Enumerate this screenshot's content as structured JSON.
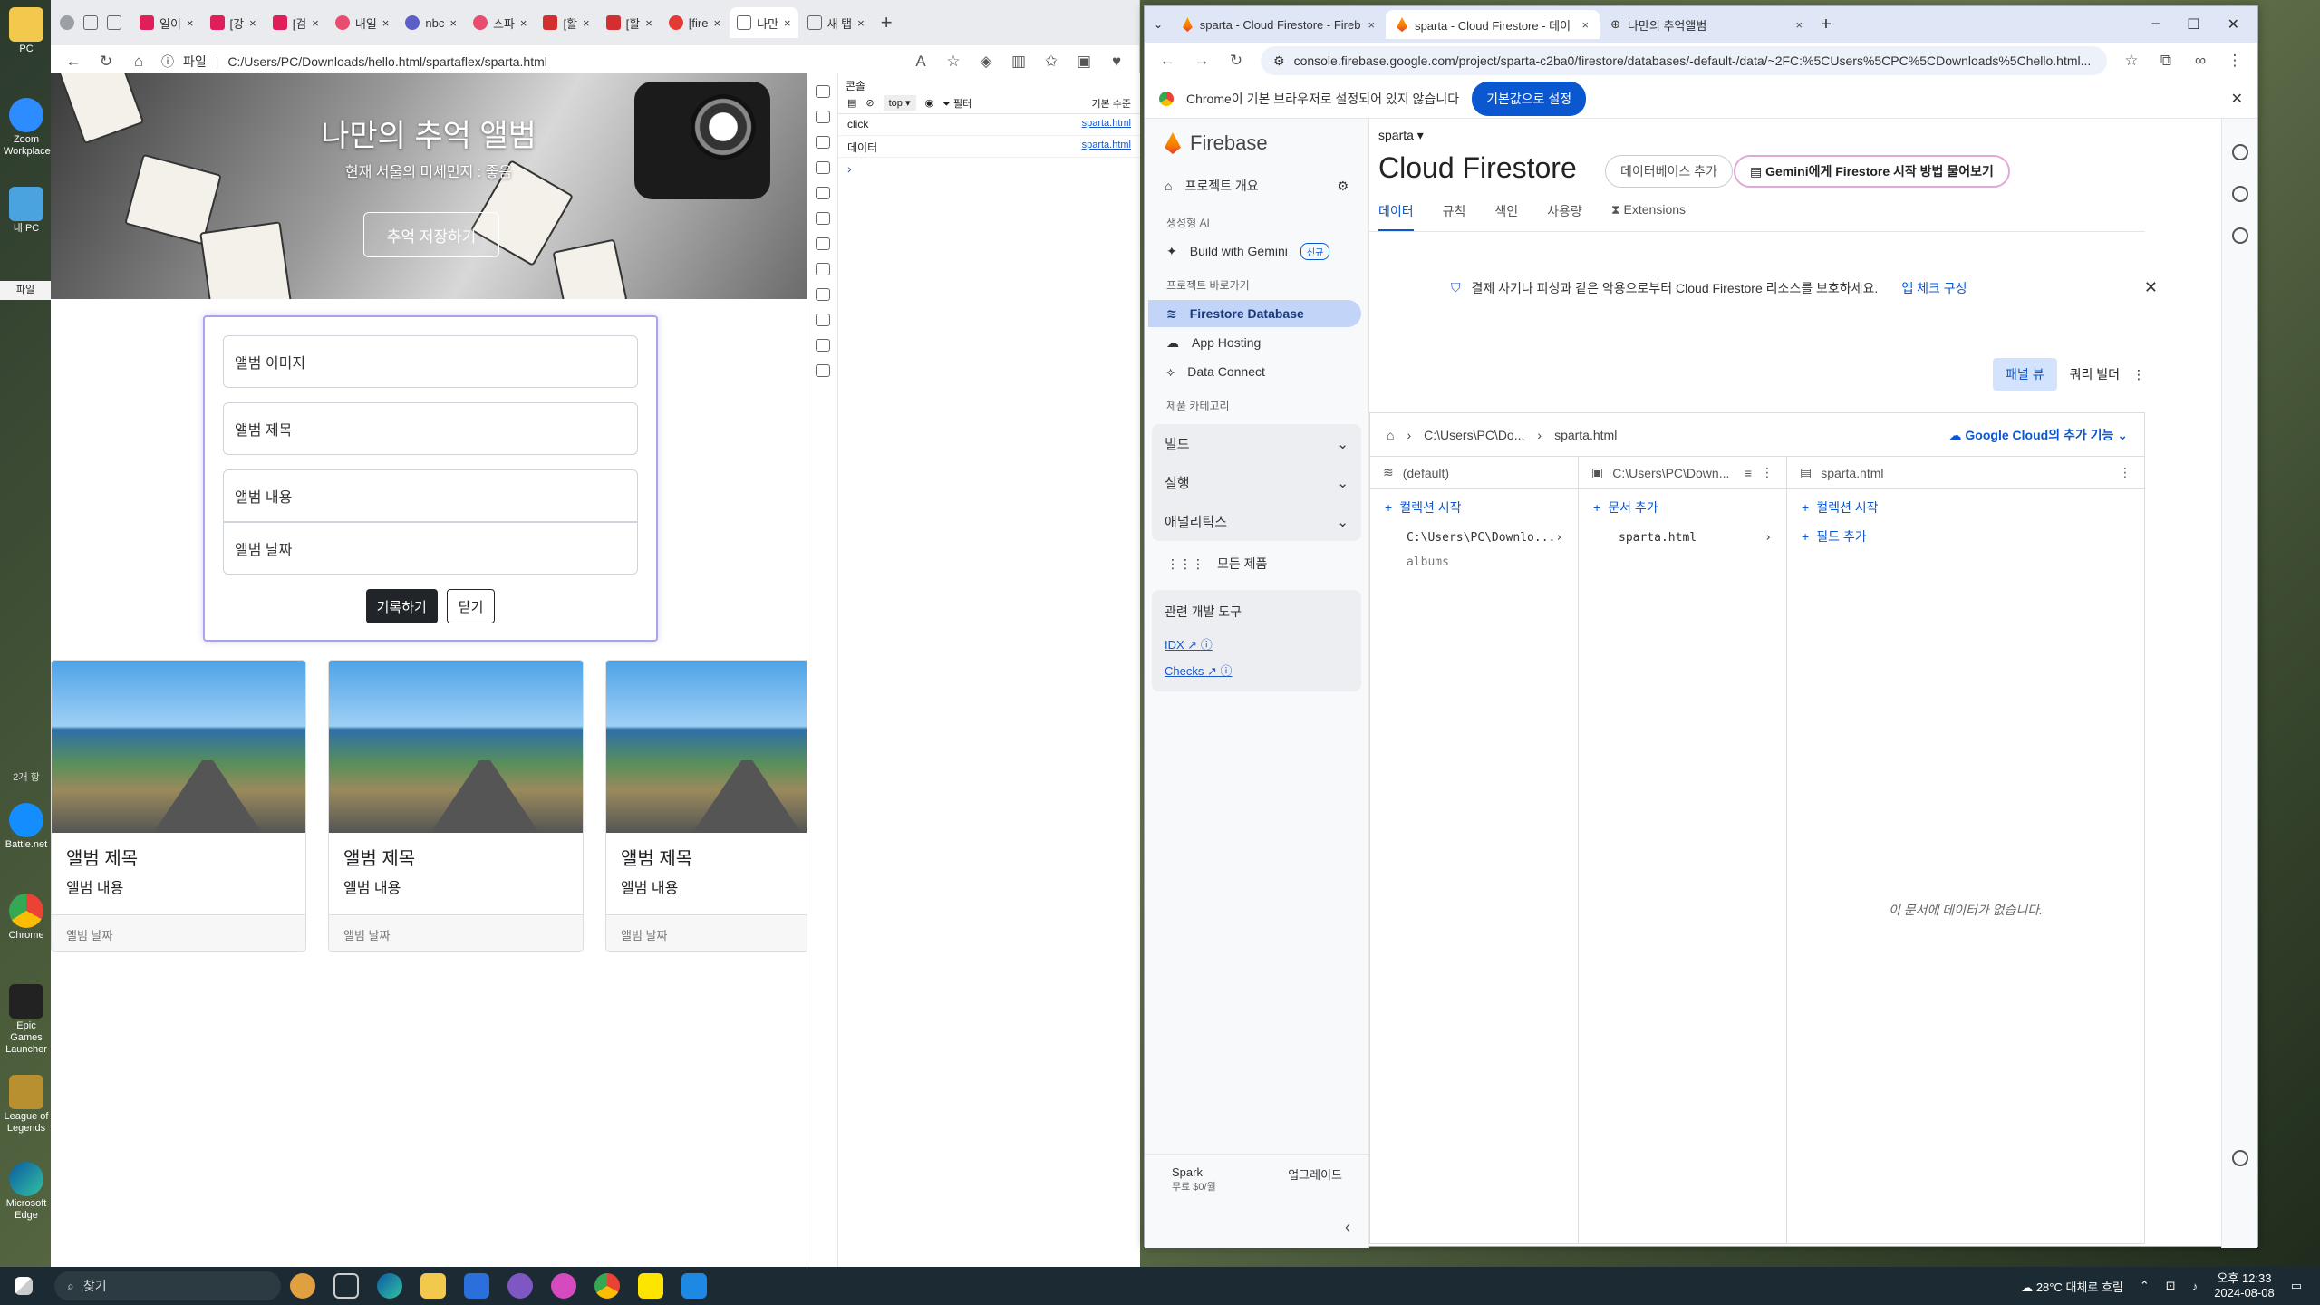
{
  "desktop": {
    "icons": [
      "PC",
      "Zoom Workplace",
      "내 PC",
      "파일",
      "2개 항",
      "Battle.net",
      "Chrome",
      "Epic Games Launcher",
      "League of Legends",
      "Microsoft Edge"
    ]
  },
  "left_browser": {
    "tabs": [
      "일이",
      "[강",
      "[검",
      "내일",
      "nbc",
      "스파",
      "[활",
      "[활",
      "[fire",
      "나만",
      "새 탭"
    ],
    "address_prefix": "파일",
    "url": "C:/Users/PC/Downloads/hello.html/spartaflex/sparta.html",
    "page": {
      "hero_title": "나만의 추억 앨범",
      "hero_subtitle": "현재 서울의 미세먼지 : 좋음",
      "hero_button": "추억 저장하기",
      "form": {
        "image_placeholder": "앨범 이미지",
        "title_placeholder": "앨범 제목",
        "content_placeholder": "앨범 내용",
        "date_placeholder": "앨범 날짜",
        "submit_button": "기록하기",
        "close_button": "닫기"
      },
      "cards": [
        {
          "title": "앨범 제목",
          "content": "앨범 내용",
          "date": "앨범 날짜"
        },
        {
          "title": "앨범 제목",
          "content": "앨범 내용",
          "date": "앨범 날짜"
        },
        {
          "title": "앨범 제목",
          "content": "앨범 내용",
          "date": "앨범 날짜"
        }
      ]
    },
    "devtools": {
      "panel_title": "콘솔",
      "context": "top",
      "filter_placeholder": "필터",
      "level": "기본 수준",
      "logs": [
        {
          "text": "click",
          "source": "sparta.html"
        },
        {
          "text": "데이터",
          "source": "sparta.html"
        }
      ]
    }
  },
  "right_browser": {
    "tabs": [
      {
        "title": "sparta - Cloud Firestore - Fireb",
        "active": false
      },
      {
        "title": "sparta - Cloud Firestore - 데이",
        "active": true
      },
      {
        "title": "나만의 추억앨범",
        "active": false
      }
    ],
    "url": "console.firebase.google.com/project/sparta-c2ba0/firestore/databases/-default-/data/~2FC:%5CUsers%5CPC%5CDownloads%5Chello.html...",
    "infobar": {
      "message": "Chrome이 기본 브라우저로 설정되어 있지 않습니다",
      "button": "기본값으로 설정"
    }
  },
  "firebase": {
    "brand": "Firebase",
    "project": "sparta",
    "sidebar": {
      "overview": "프로젝트 개요",
      "section_ai": "생성형 AI",
      "build_gemini": "Build with Gemini",
      "new_badge": "신규",
      "section_shortcuts": "프로젝트 바로가기",
      "shortcuts": [
        "Firestore Database",
        "App Hosting",
        "Data Connect"
      ],
      "section_category": "제품 카테고리",
      "groups": [
        "빌드",
        "실행",
        "애널리틱스"
      ],
      "all_products": "모든 제품",
      "related_tools_title": "관련 개발 도구",
      "related_tools": [
        "IDX",
        "Checks"
      ],
      "plan": "Spark",
      "plan_price": "무료 $0/월",
      "upgrade": "업그레이드"
    },
    "main": {
      "title": "Cloud Firestore",
      "add_db": "데이터베이스 추가",
      "gemini_prompt": "Gemini에게 Firestore 시작 방법 물어보기",
      "tabs": [
        "데이터",
        "규칙",
        "색인",
        "사용량",
        "Extensions"
      ],
      "banner_text": "결제 사기나 피싱과 같은 악용으로부터 Cloud Firestore 리소스를 보호하세요.",
      "banner_link": "앱 체크 구성",
      "view_panel": "패널 뷰",
      "view_query": "쿼리 빌더",
      "breadcrumb": [
        "C:\\Users\\PC\\Do...",
        "sparta.html"
      ],
      "gcloud_more": "Google Cloud의 추가 기능",
      "col1": {
        "header": "(default)",
        "add": "컬렉션 시작",
        "items": [
          "C:\\Users\\PC\\Downlo...",
          "albums"
        ]
      },
      "col2": {
        "header": "C:\\Users\\PC\\Down...",
        "add": "문서 추가",
        "items": [
          "sparta.html"
        ]
      },
      "col3": {
        "header": "sparta.html",
        "add_collection": "컬렉션 시작",
        "add_field": "필드 추가",
        "empty": "이 문서에 데이터가 없습니다."
      }
    }
  },
  "taskbar": {
    "search": "찾기",
    "weather": "28°C 대체로 흐림",
    "time": "오후 12:33",
    "date": "2024-08-08"
  }
}
